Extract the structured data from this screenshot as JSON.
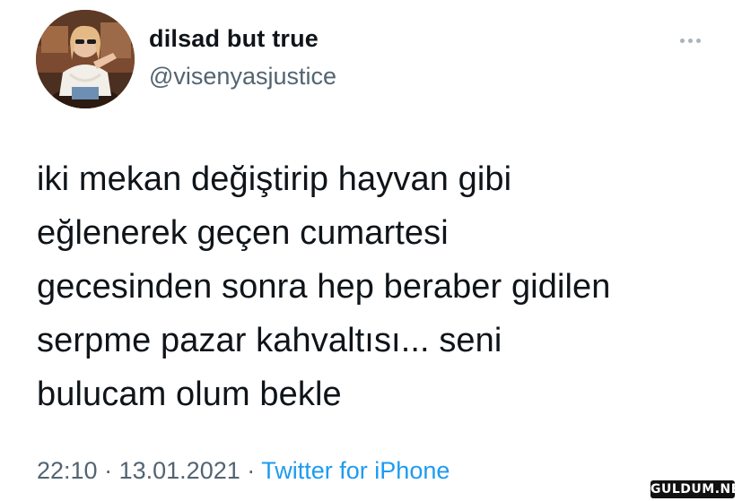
{
  "tweet": {
    "display_name": "dilsad but true",
    "handle": "@visenyasjustice",
    "text_lines": [
      "iki mekan değiştirip hayvan gibi",
      "eğlenerek geçen cumartesi",
      "gecesinden sonra hep beraber gidilen",
      "serpme pazar kahvaltısı... seni",
      "bulucam olum bekle"
    ],
    "time": "22:10",
    "date": "13.01.2021",
    "separator": "·",
    "source": "Twitter for iPhone"
  },
  "icons": {
    "more": "more-horizontal-icon",
    "avatar": "profile-photo"
  },
  "watermark": "GULDUM.NET",
  "colors": {
    "text": "#0f1419",
    "secondary": "#536471",
    "link": "#1d9bf0",
    "background": "#ffffff"
  }
}
